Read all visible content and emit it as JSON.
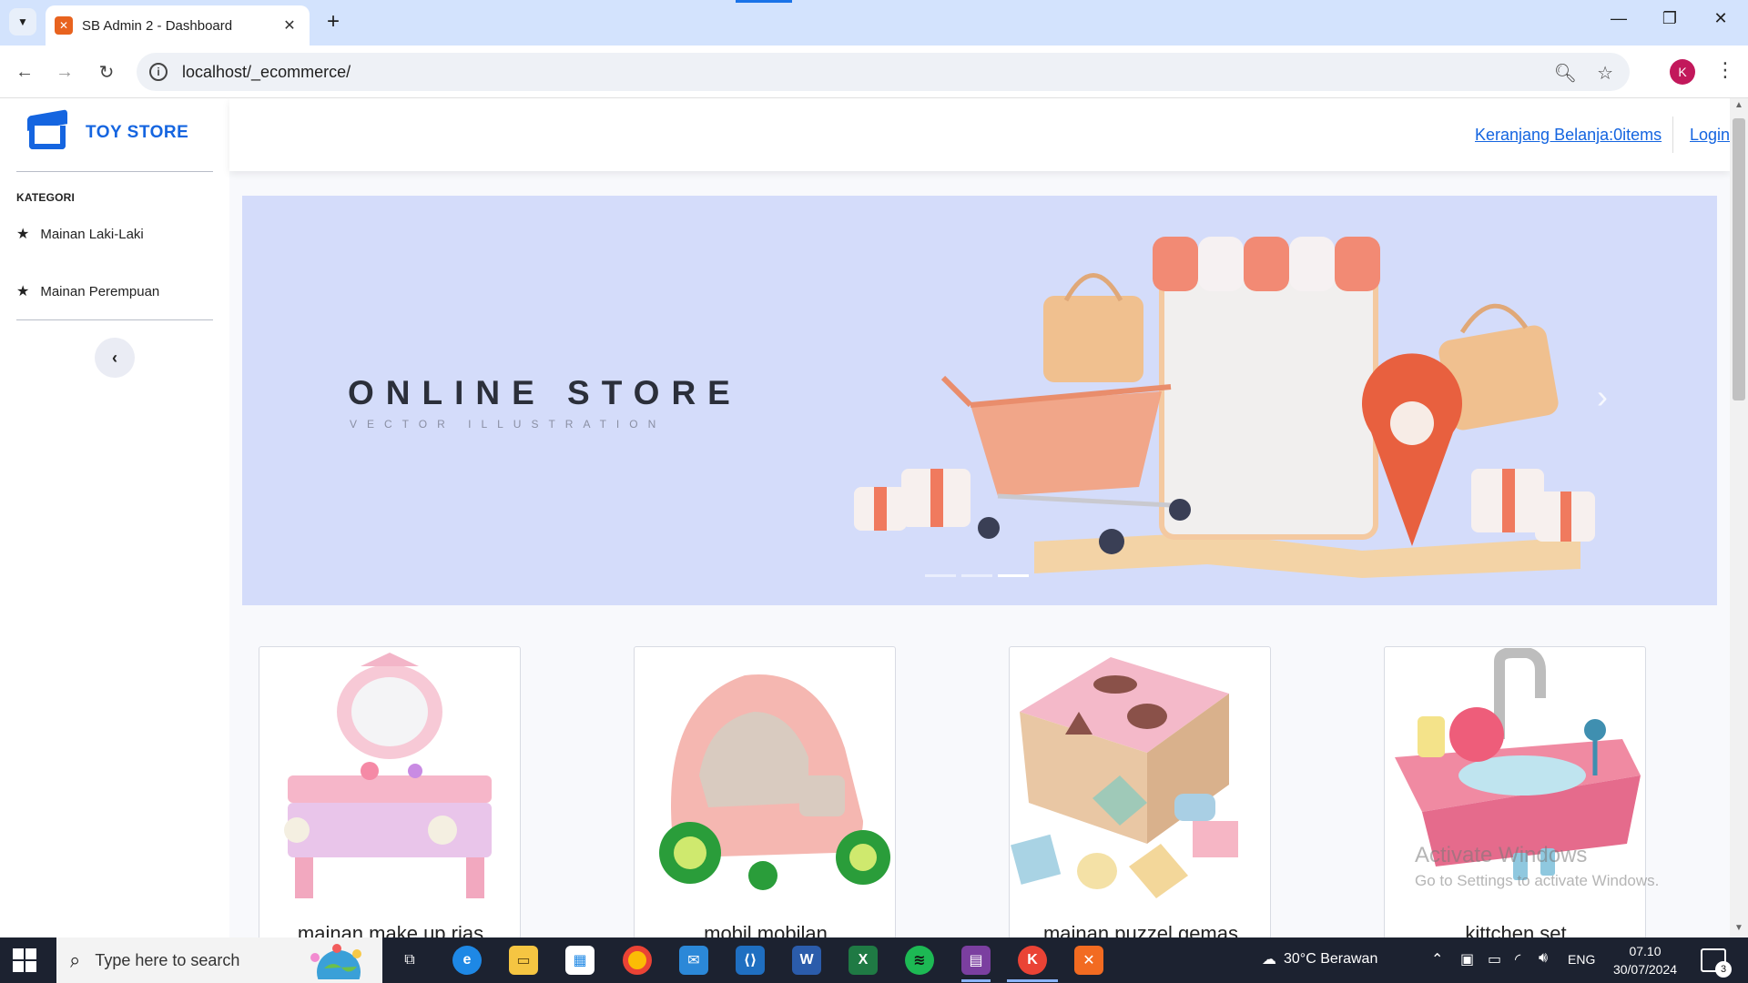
{
  "browser": {
    "tab_title": "SB Admin 2 - Dashboard",
    "url": "localhost/_ecommerce/",
    "profile_initial": "K"
  },
  "site": {
    "brand": "TOY STORE",
    "sidebar": {
      "heading": "KATEGORI",
      "items": [
        {
          "label": "Mainan Laki-Laki",
          "icon": "star-icon"
        },
        {
          "label": "Mainan Perempuan",
          "icon": "star-icon"
        }
      ]
    },
    "topbar": {
      "cart": "Keranjang Belanja:0items",
      "login": "Login"
    },
    "banner": {
      "title": "ONLINE STORE",
      "subtitle": "VECTOR ILLUSTRATION",
      "slides": 3,
      "active_slide": 3
    },
    "products": [
      {
        "name": "mainan make up rias"
      },
      {
        "name": "mobil mobilan"
      },
      {
        "name": "mainan puzzel gemas"
      },
      {
        "name": "kittchen set"
      }
    ],
    "colors": {
      "accent": "#1565e0",
      "banner_bg": "#d4dcfa"
    }
  },
  "watermark": {
    "line1": "Activate Windows",
    "line2": "Go to Settings to activate Windows."
  },
  "taskbar": {
    "search_placeholder": "Type here to search",
    "weather": "30°C  Berawan",
    "language": "ENG",
    "time": "07.10",
    "date": "30/07/2024",
    "notification_count": "3"
  }
}
